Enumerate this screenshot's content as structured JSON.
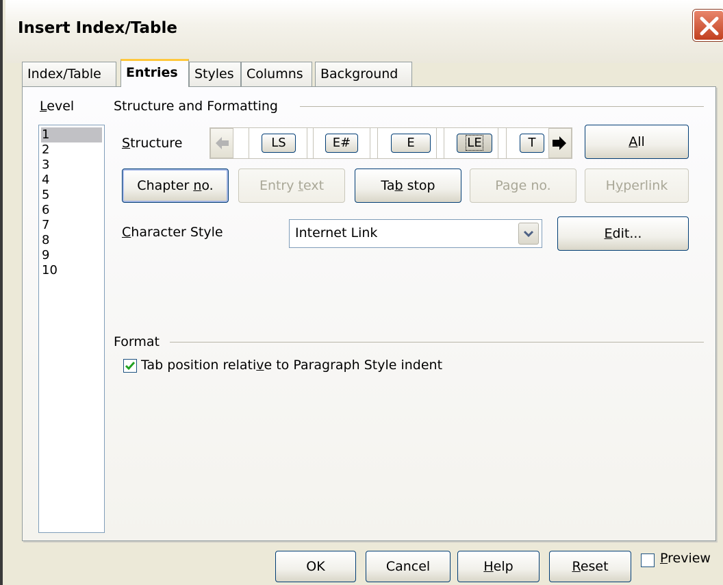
{
  "window": {
    "title": "Insert Index/Table"
  },
  "tabs": [
    {
      "label": "Index/Table"
    },
    {
      "label": "Entries"
    },
    {
      "label": "Styles"
    },
    {
      "label": "Columns"
    },
    {
      "label": "Background"
    }
  ],
  "level": {
    "label": "Level",
    "items": [
      "1",
      "2",
      "3",
      "4",
      "5",
      "6",
      "7",
      "8",
      "9",
      "10"
    ],
    "selected": "1"
  },
  "structure_section": {
    "title": "Structure and Formatting",
    "structure_label": "Structure",
    "tokens": [
      "LS",
      "E#",
      "E",
      "LE",
      "T"
    ],
    "focused_token": "LE",
    "all_button": "All"
  },
  "insert_buttons": {
    "chapter_no": "Chapter no.",
    "entry_text": "Entry text",
    "tab_stop": "Tab stop",
    "page_no": "Page no.",
    "hyperlink": "Hyperlink"
  },
  "character_style": {
    "label": "Character Style",
    "value": "Internet Link",
    "edit_button": "Edit..."
  },
  "format_section": {
    "title": "Format",
    "tab_position_checkbox": "Tab position relative to Paragraph Style indent",
    "tab_position_checked": true
  },
  "footer": {
    "ok": "OK",
    "cancel": "Cancel",
    "help": "Help",
    "reset": "Reset",
    "preview": "Preview",
    "preview_checked": false
  },
  "colors": {
    "title_close": "#c2401f",
    "active_tab_accent": "#ffc83c",
    "button_border": "#003c74",
    "check_mark": "#21a121"
  },
  "icons": {
    "close": "close-x-icon",
    "left": "left-arrow-icon",
    "right": "right-arrow-icon",
    "dropdown": "chevron-down-icon",
    "check": "check-icon"
  }
}
